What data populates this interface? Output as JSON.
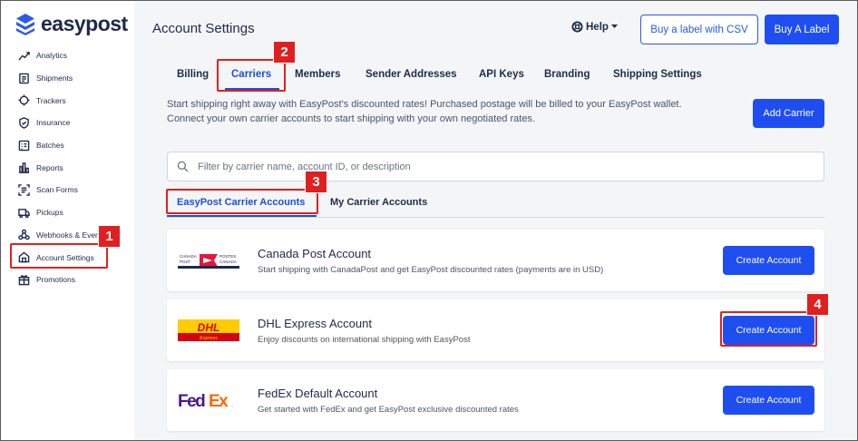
{
  "brand": {
    "name": "easypost"
  },
  "sidebar": {
    "items": [
      {
        "label": "Analytics",
        "icon": "analytics-icon"
      },
      {
        "label": "Shipments",
        "icon": "shipments-icon"
      },
      {
        "label": "Trackers",
        "icon": "trackers-icon"
      },
      {
        "label": "Insurance",
        "icon": "insurance-icon"
      },
      {
        "label": "Batches",
        "icon": "batches-icon"
      },
      {
        "label": "Reports",
        "icon": "reports-icon"
      },
      {
        "label": "Scan Forms",
        "icon": "scan-forms-icon"
      },
      {
        "label": "Pickups",
        "icon": "pickups-icon"
      },
      {
        "label": "Webhooks & Events",
        "icon": "webhooks-icon"
      },
      {
        "label": "Account Settings",
        "icon": "account-settings-icon"
      },
      {
        "label": "Promotions",
        "icon": "promotions-icon"
      }
    ]
  },
  "header": {
    "title": "Account Settings",
    "help_label": "Help",
    "csv_button": "Buy a label with CSV",
    "buy_button": "Buy A Label"
  },
  "tabs": [
    {
      "label": "Billing"
    },
    {
      "label": "Carriers"
    },
    {
      "label": "Members"
    },
    {
      "label": "Sender Addresses"
    },
    {
      "label": "API Keys"
    },
    {
      "label": "Branding"
    },
    {
      "label": "Shipping Settings"
    }
  ],
  "carriers": {
    "intro_line1": "Start shipping right away with EasyPost's discounted rates! Purchased postage will be billed to your EasyPost wallet.",
    "intro_line2": "Connect your own carrier accounts to start shipping with your own negotiated rates.",
    "add_button": "Add Carrier",
    "search_placeholder": "Filter by carrier name, account ID, or description",
    "subtabs": [
      {
        "label": "EasyPost Carrier Accounts"
      },
      {
        "label": "My Carrier Accounts"
      }
    ],
    "accounts": [
      {
        "title": "Canada Post Account",
        "description": "Start shipping with CanadaPost and get EasyPost discounted rates (payments are in USD)",
        "button": "Create Account",
        "logo_text": [
          "CANADA",
          "POSTES",
          "POST",
          "CANADA"
        ]
      },
      {
        "title": "DHL Express Account",
        "description": "Enjoy discounts on international shipping with EasyPost",
        "button": "Create Account",
        "logo_text": [
          "DHL",
          "Express"
        ]
      },
      {
        "title": "FedEx Default Account",
        "description": "Get started with FedEx and get EasyPost exclusive discounted rates",
        "button": "Create Account",
        "logo_text": [
          "Fed",
          "Ex",
          "."
        ]
      }
    ]
  },
  "annotations": [
    "1",
    "2",
    "3",
    "4"
  ],
  "colors": {
    "primary": "#1f4ef0",
    "annotation": "#e02020",
    "dhl_yellow": "#fc0",
    "dhl_red": "#d40511",
    "fedex_purple": "#4d148c",
    "fedex_orange": "#ff6600",
    "canada_post_red": "#e31837"
  }
}
